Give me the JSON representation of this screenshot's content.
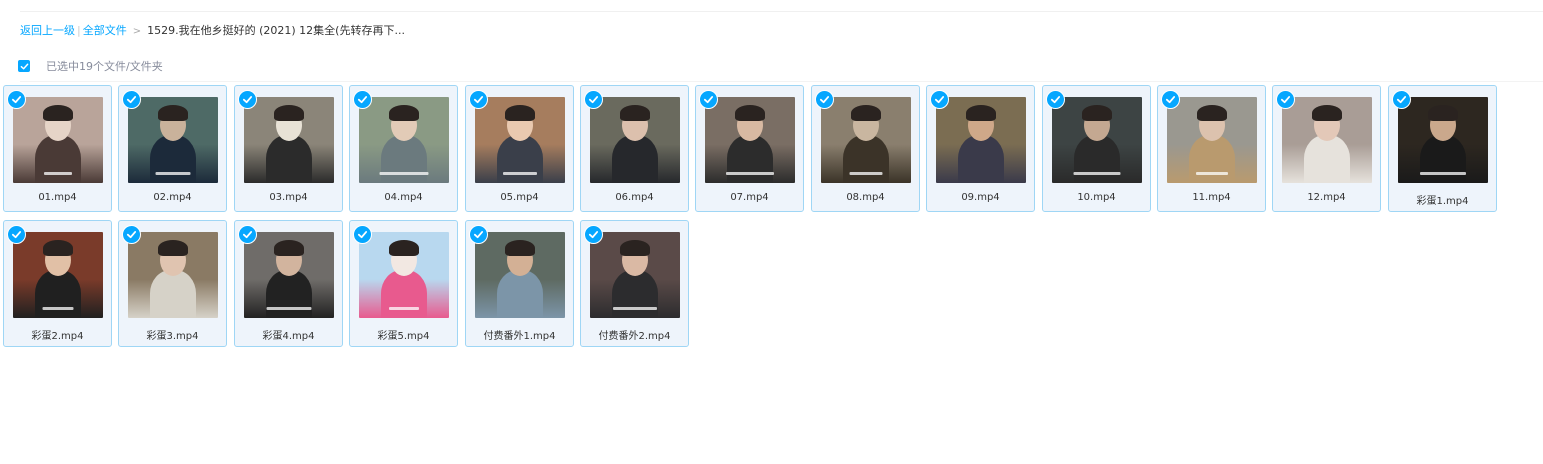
{
  "breadcrumb": {
    "back": "返回上一级",
    "divider": "|",
    "all_files": "全部文件",
    "arrow": ">",
    "current": "1529.我在他乡挺好的 (2021) 12集全(先转存再下..."
  },
  "selection": {
    "checked": true,
    "text": "已选中19个文件/文件夹"
  },
  "colors": {
    "accent": "#06a7ff",
    "tile_bg": "#eef4fb",
    "tile_border": "#9fd6f5"
  },
  "files": [
    {
      "name": "01.mp4",
      "type": "video",
      "selected": true
    },
    {
      "name": "02.mp4",
      "type": "video",
      "selected": true
    },
    {
      "name": "03.mp4",
      "type": "video",
      "selected": true
    },
    {
      "name": "04.mp4",
      "type": "video",
      "selected": true
    },
    {
      "name": "05.mp4",
      "type": "video",
      "selected": true
    },
    {
      "name": "06.mp4",
      "type": "video",
      "selected": true
    },
    {
      "name": "07.mp4",
      "type": "video",
      "selected": true
    },
    {
      "name": "08.mp4",
      "type": "video",
      "selected": true
    },
    {
      "name": "09.mp4",
      "type": "video",
      "selected": true
    },
    {
      "name": "10.mp4",
      "type": "video",
      "selected": true
    },
    {
      "name": "11.mp4",
      "type": "video",
      "selected": true
    },
    {
      "name": "12.mp4",
      "type": "video",
      "selected": true
    },
    {
      "name": "彩蛋1.mp4",
      "type": "video",
      "selected": true
    },
    {
      "name": "彩蛋2.mp4",
      "type": "video",
      "selected": true
    },
    {
      "name": "彩蛋3.mp4",
      "type": "video",
      "selected": true
    },
    {
      "name": "彩蛋4.mp4",
      "type": "video",
      "selected": true
    },
    {
      "name": "彩蛋5.mp4",
      "type": "video",
      "selected": true
    },
    {
      "name": "付费番外1.mp4",
      "type": "video",
      "selected": true
    },
    {
      "name": "付费番外2.mp4",
      "type": "video",
      "selected": true
    }
  ]
}
